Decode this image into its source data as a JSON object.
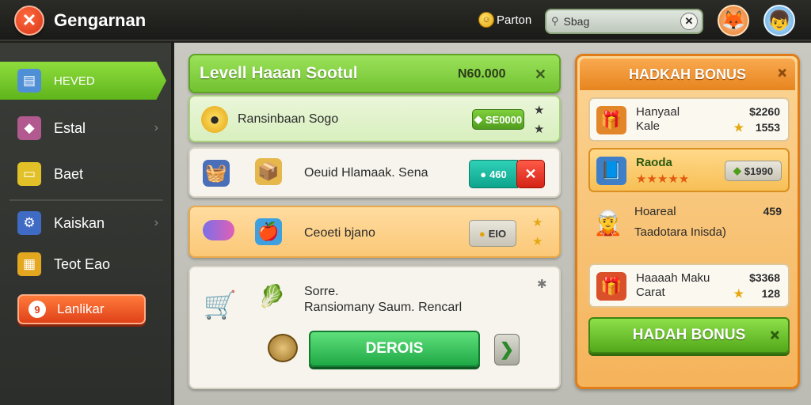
{
  "header": {
    "title": "Gengarnan",
    "profile_name": "Parton",
    "search_value": "Sbag",
    "close_glyph": "✕"
  },
  "sidebar": {
    "items": [
      {
        "label": "HEVED",
        "icon": "chest-icon"
      },
      {
        "label": "Estal",
        "icon": "box-icon"
      },
      {
        "label": "Baet",
        "icon": "card-icon"
      },
      {
        "label": "Kaiskan",
        "icon": "gear-box-icon"
      },
      {
        "label": "Teot Eao",
        "icon": "crate-icon"
      }
    ],
    "action_label": "Lanlikar"
  },
  "level_panel": {
    "title": "Levell Haaan Sootul",
    "reward": "N60.000",
    "rows": [
      {
        "label": "Ransinbaan Sogo",
        "badge": "SE0000"
      },
      {
        "label": "Oeuid Hlamaak. Sena",
        "badge": "460"
      },
      {
        "label": "Ceoeti bjano",
        "badge": "EIO"
      }
    ],
    "bottom": {
      "line1": "Sorre.",
      "line2": "Ransiomany Saum. Rencarl",
      "button_label": "DEROIS"
    }
  },
  "bonus_panel": {
    "title": "HADKAH BONUS",
    "items": [
      {
        "name_line1": "Hanyaal",
        "name_line2": "Kale",
        "price": "$2260",
        "sub_price": "1553"
      },
      {
        "name_line1": "Raoda",
        "name_line2": "",
        "price": "$1990",
        "sub_price": ""
      },
      {
        "name_line1": "Hoareal",
        "name_line2": "Taadotara Inisda)",
        "price": "459",
        "sub_price": ""
      },
      {
        "name_line1": "Haaaah Maku",
        "name_line2": "Carat",
        "price": "$3368",
        "sub_price": "128"
      }
    ],
    "button_label": "HADAH BONUS"
  },
  "colors": {
    "accent_green": "#72c231",
    "bonus_orange": "#e7851f",
    "danger_red": "#d9361b"
  }
}
